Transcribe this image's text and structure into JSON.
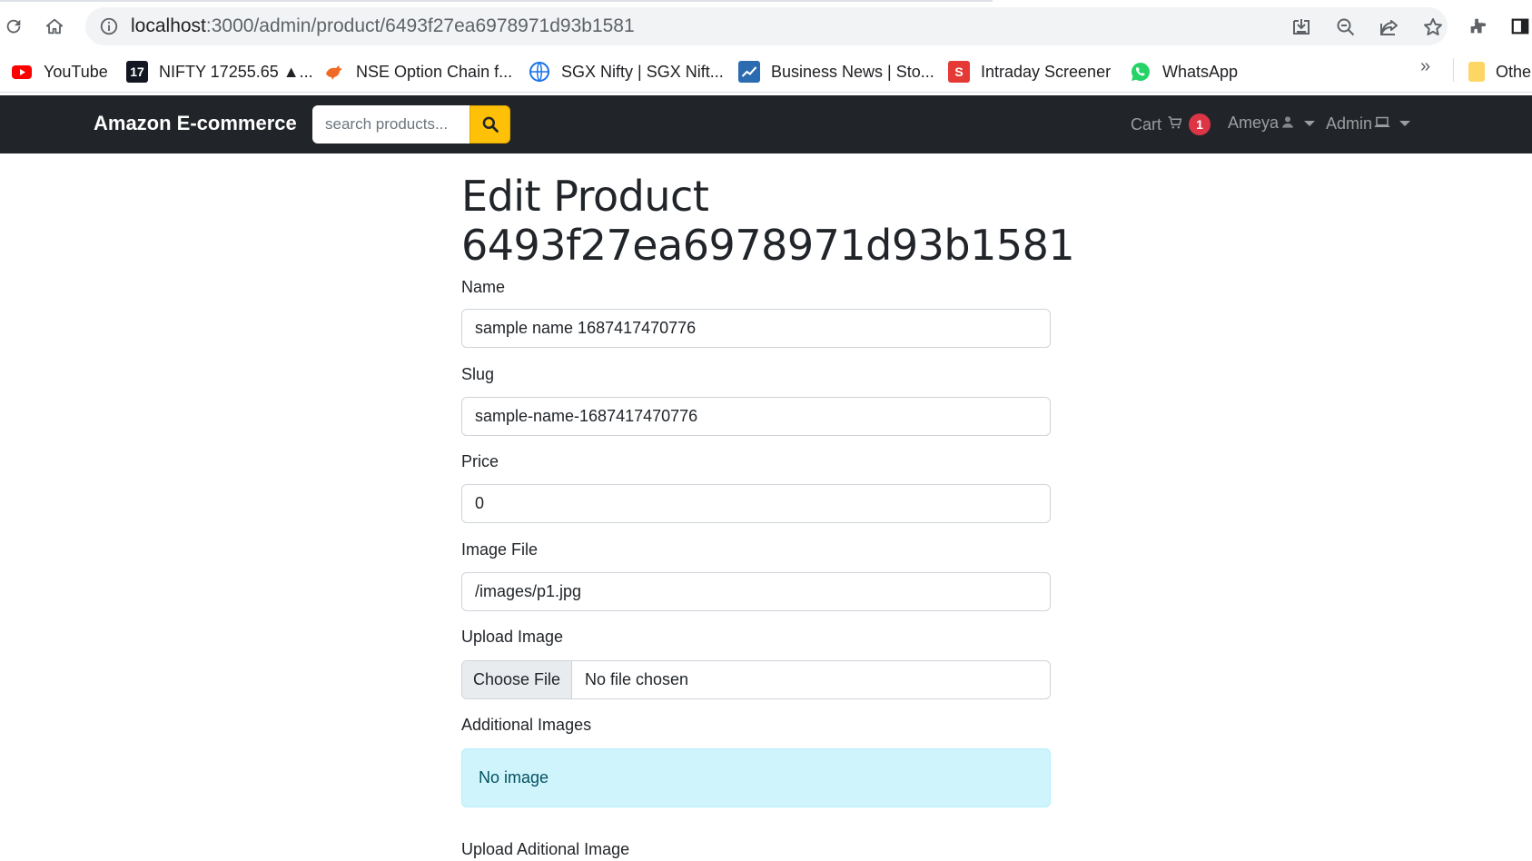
{
  "browser": {
    "url_host": "localhost",
    "url_path": ":3000/admin/product/6493f27ea6978971d93b1581",
    "bookmarks": [
      {
        "label": "YouTube",
        "icon": "youtube-icon",
        "color": "#ff0000"
      },
      {
        "label": "NIFTY 17255.65 ▲...",
        "icon": "tradingview-icon",
        "color": "#131722"
      },
      {
        "label": "NSE Option Chain f...",
        "icon": "bull-icon",
        "color": "#f06a25"
      },
      {
        "label": "SGX Nifty | SGX Nift...",
        "icon": "globe-icon",
        "color": "#1a73e8"
      },
      {
        "label": "Business News | Sto...",
        "icon": "chart-icon",
        "color": "#2b6cb0"
      },
      {
        "label": "Intraday Screener",
        "icon": "screener-icon",
        "color": "#e53935"
      },
      {
        "label": "WhatsApp",
        "icon": "whatsapp-icon",
        "color": "#25d366"
      }
    ],
    "more_label": "»",
    "other_bookmarks_label": "Othe"
  },
  "navbar": {
    "brand": "Amazon E-commerce",
    "search_placeholder": "search products...",
    "cart_label": "Cart",
    "cart_count": "1",
    "user_label": "Ameya",
    "admin_label": "Admin"
  },
  "form": {
    "title_line1": "Edit Product",
    "title_line2": "6493f27ea6978971d93b1581",
    "name_label": "Name",
    "name_value": "sample name 1687417470776",
    "slug_label": "Slug",
    "slug_value": "sample-name-1687417470776",
    "price_label": "Price",
    "price_value": "0",
    "image_label": "Image File",
    "image_value": "/images/p1.jpg",
    "upload_label": "Upload Image",
    "choose_file": "Choose File",
    "no_file": "No file chosen",
    "additional_label": "Additional Images",
    "no_image": "No image",
    "upload_additional_label": "Upload Aditional Image"
  },
  "colors": {
    "navbar_bg": "#212529",
    "search_button": "#ffc107",
    "badge": "#dc3545",
    "alert_info_bg": "#cff4fc"
  }
}
